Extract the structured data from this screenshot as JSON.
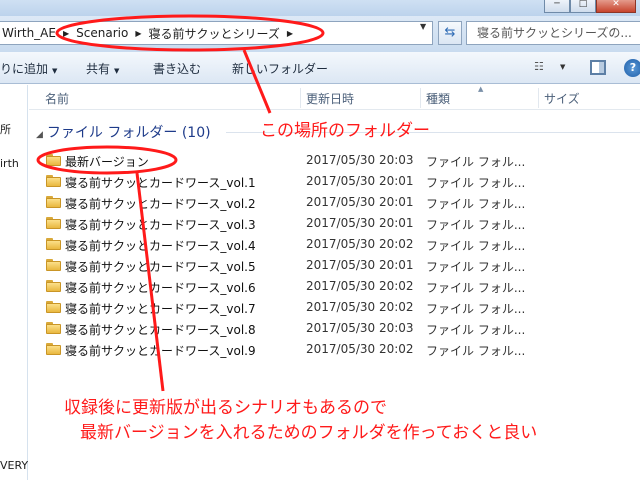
{
  "window": {
    "minimize_label": "─",
    "maximize_label": "□",
    "close_label": "✕"
  },
  "address": {
    "crumbs": [
      "Wirth_AE",
      "Scenario",
      "寝る前サクッとシリーズ"
    ],
    "dropdown_glyph": "▼",
    "refresh_glyph": "⇆",
    "search_placeholder": "寝る前サクッとシリーズの..."
  },
  "toolbar": {
    "include_label": "りに追加",
    "share_label": "共有",
    "burn_label": "書き込む",
    "new_folder_label": "新しいフォルダー",
    "help_label": "?"
  },
  "nav": {
    "item1": "所",
    "item2": "irth",
    "item3": "VERY"
  },
  "columns": {
    "name": "名前",
    "date": "更新日時",
    "type": "種類",
    "size": "サイズ"
  },
  "group": {
    "label": "ファイル フォルダー (10)"
  },
  "files": [
    {
      "name": "最新バージョン",
      "date": "2017/05/30 20:03",
      "type": "ファイル フォル..."
    },
    {
      "name": "寝る前サクッとカードワース_vol.1",
      "date": "2017/05/30 20:01",
      "type": "ファイル フォル..."
    },
    {
      "name": "寝る前サクッとカードワース_vol.2",
      "date": "2017/05/30 20:01",
      "type": "ファイル フォル..."
    },
    {
      "name": "寝る前サクッとカードワース_vol.3",
      "date": "2017/05/30 20:01",
      "type": "ファイル フォル..."
    },
    {
      "name": "寝る前サクッとカードワース_vol.4",
      "date": "2017/05/30 20:02",
      "type": "ファイル フォル..."
    },
    {
      "name": "寝る前サクッとカードワース_vol.5",
      "date": "2017/05/30 20:01",
      "type": "ファイル フォル..."
    },
    {
      "name": "寝る前サクッとカードワース_vol.6",
      "date": "2017/05/30 20:02",
      "type": "ファイル フォル..."
    },
    {
      "name": "寝る前サクッとカードワース_vol.7",
      "date": "2017/05/30 20:02",
      "type": "ファイル フォル..."
    },
    {
      "name": "寝る前サクッとカードワース_vol.8",
      "date": "2017/05/30 20:03",
      "type": "ファイル フォル..."
    },
    {
      "name": "寝る前サクッとカードワース_vol.9",
      "date": "2017/05/30 20:02",
      "type": "ファイル フォル..."
    }
  ],
  "annotations": {
    "location_note": "この場所のフォルダー",
    "tip_line1": "収録後に更新版が出るシナリオもあるので",
    "tip_line2": "最新バージョンを入れるためのフォルダを作っておくと良い"
  },
  "colors": {
    "annotation": "#ff1a1a",
    "group_header": "#1e3b8a",
    "folder": "#f2c75c"
  }
}
